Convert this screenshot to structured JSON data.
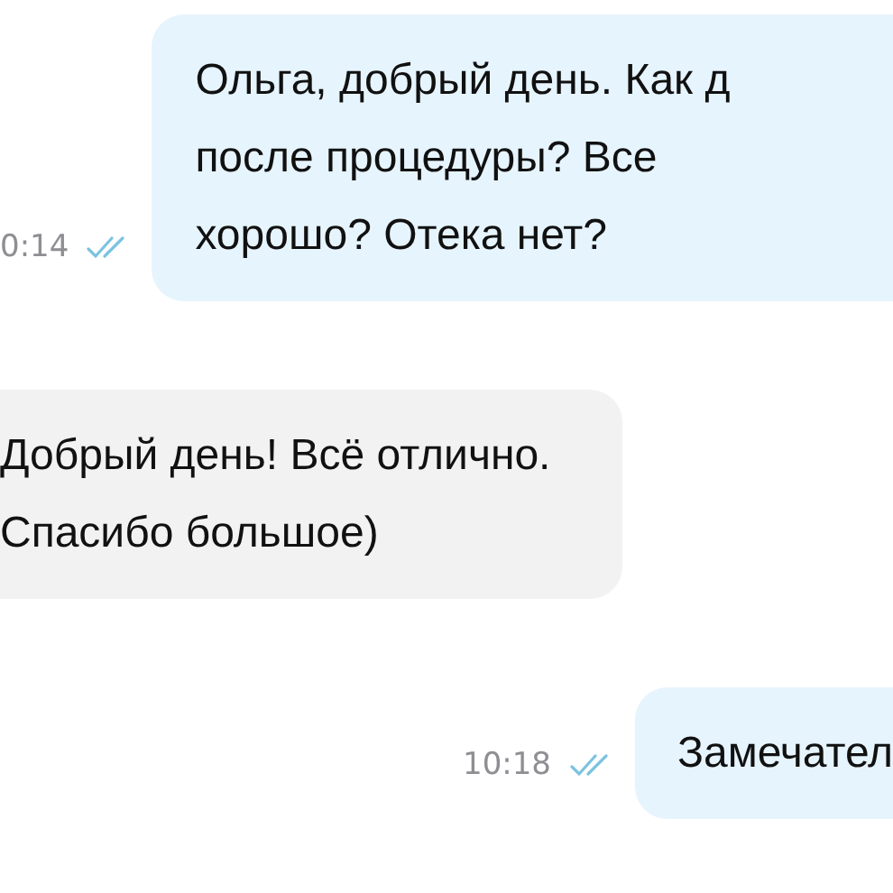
{
  "messages": [
    {
      "kind": "outgoing",
      "text": "Ольга, добрый день. Как д\nпосле процедуры? Все\nхорошо? Отека нет?",
      "time": "0:14",
      "read": true
    },
    {
      "kind": "incoming",
      "text": "Добрый день! Всё отлично.\nСпасибо большое)"
    },
    {
      "kind": "outgoing",
      "text": "Замечател",
      "time": "10:18",
      "read": true
    }
  ]
}
